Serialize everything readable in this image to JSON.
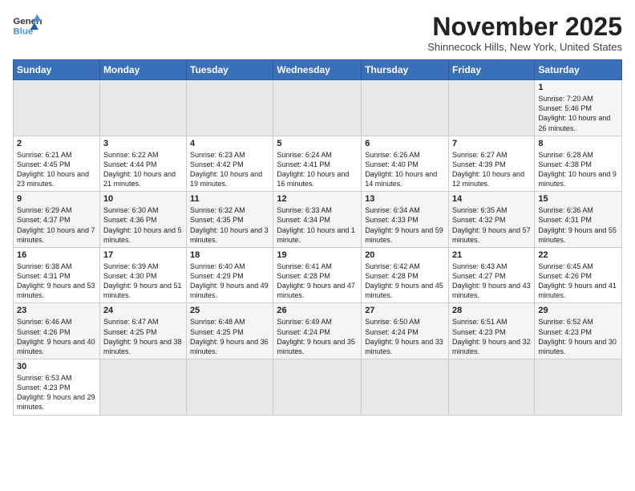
{
  "header": {
    "logo_general": "General",
    "logo_blue": "Blue",
    "month": "November 2025",
    "location": "Shinnecock Hills, New York, United States"
  },
  "weekdays": [
    "Sunday",
    "Monday",
    "Tuesday",
    "Wednesday",
    "Thursday",
    "Friday",
    "Saturday"
  ],
  "weeks": [
    [
      {
        "day": "",
        "info": ""
      },
      {
        "day": "",
        "info": ""
      },
      {
        "day": "",
        "info": ""
      },
      {
        "day": "",
        "info": ""
      },
      {
        "day": "",
        "info": ""
      },
      {
        "day": "",
        "info": ""
      },
      {
        "day": "1",
        "info": "Sunrise: 7:20 AM\nSunset: 5:46 PM\nDaylight: 10 hours and 26 minutes."
      }
    ],
    [
      {
        "day": "2",
        "info": "Sunrise: 6:21 AM\nSunset: 4:45 PM\nDaylight: 10 hours and 23 minutes."
      },
      {
        "day": "3",
        "info": "Sunrise: 6:22 AM\nSunset: 4:44 PM\nDaylight: 10 hours and 21 minutes."
      },
      {
        "day": "4",
        "info": "Sunrise: 6:23 AM\nSunset: 4:42 PM\nDaylight: 10 hours and 19 minutes."
      },
      {
        "day": "5",
        "info": "Sunrise: 6:24 AM\nSunset: 4:41 PM\nDaylight: 10 hours and 16 minutes."
      },
      {
        "day": "6",
        "info": "Sunrise: 6:26 AM\nSunset: 4:40 PM\nDaylight: 10 hours and 14 minutes."
      },
      {
        "day": "7",
        "info": "Sunrise: 6:27 AM\nSunset: 4:39 PM\nDaylight: 10 hours and 12 minutes."
      },
      {
        "day": "8",
        "info": "Sunrise: 6:28 AM\nSunset: 4:38 PM\nDaylight: 10 hours and 9 minutes."
      }
    ],
    [
      {
        "day": "9",
        "info": "Sunrise: 6:29 AM\nSunset: 4:37 PM\nDaylight: 10 hours and 7 minutes."
      },
      {
        "day": "10",
        "info": "Sunrise: 6:30 AM\nSunset: 4:36 PM\nDaylight: 10 hours and 5 minutes."
      },
      {
        "day": "11",
        "info": "Sunrise: 6:32 AM\nSunset: 4:35 PM\nDaylight: 10 hours and 3 minutes."
      },
      {
        "day": "12",
        "info": "Sunrise: 6:33 AM\nSunset: 4:34 PM\nDaylight: 10 hours and 1 minute."
      },
      {
        "day": "13",
        "info": "Sunrise: 6:34 AM\nSunset: 4:33 PM\nDaylight: 9 hours and 59 minutes."
      },
      {
        "day": "14",
        "info": "Sunrise: 6:35 AM\nSunset: 4:32 PM\nDaylight: 9 hours and 57 minutes."
      },
      {
        "day": "15",
        "info": "Sunrise: 6:36 AM\nSunset: 4:31 PM\nDaylight: 9 hours and 55 minutes."
      }
    ],
    [
      {
        "day": "16",
        "info": "Sunrise: 6:38 AM\nSunset: 4:31 PM\nDaylight: 9 hours and 53 minutes."
      },
      {
        "day": "17",
        "info": "Sunrise: 6:39 AM\nSunset: 4:30 PM\nDaylight: 9 hours and 51 minutes."
      },
      {
        "day": "18",
        "info": "Sunrise: 6:40 AM\nSunset: 4:29 PM\nDaylight: 9 hours and 49 minutes."
      },
      {
        "day": "19",
        "info": "Sunrise: 6:41 AM\nSunset: 4:28 PM\nDaylight: 9 hours and 47 minutes."
      },
      {
        "day": "20",
        "info": "Sunrise: 6:42 AM\nSunset: 4:28 PM\nDaylight: 9 hours and 45 minutes."
      },
      {
        "day": "21",
        "info": "Sunrise: 6:43 AM\nSunset: 4:27 PM\nDaylight: 9 hours and 43 minutes."
      },
      {
        "day": "22",
        "info": "Sunrise: 6:45 AM\nSunset: 4:26 PM\nDaylight: 9 hours and 41 minutes."
      }
    ],
    [
      {
        "day": "23",
        "info": "Sunrise: 6:46 AM\nSunset: 4:26 PM\nDaylight: 9 hours and 40 minutes."
      },
      {
        "day": "24",
        "info": "Sunrise: 6:47 AM\nSunset: 4:25 PM\nDaylight: 9 hours and 38 minutes."
      },
      {
        "day": "25",
        "info": "Sunrise: 6:48 AM\nSunset: 4:25 PM\nDaylight: 9 hours and 36 minutes."
      },
      {
        "day": "26",
        "info": "Sunrise: 6:49 AM\nSunset: 4:24 PM\nDaylight: 9 hours and 35 minutes."
      },
      {
        "day": "27",
        "info": "Sunrise: 6:50 AM\nSunset: 4:24 PM\nDaylight: 9 hours and 33 minutes."
      },
      {
        "day": "28",
        "info": "Sunrise: 6:51 AM\nSunset: 4:23 PM\nDaylight: 9 hours and 32 minutes."
      },
      {
        "day": "29",
        "info": "Sunrise: 6:52 AM\nSunset: 4:23 PM\nDaylight: 9 hours and 30 minutes."
      }
    ],
    [
      {
        "day": "30",
        "info": "Sunrise: 6:53 AM\nSunset: 4:23 PM\nDaylight: 9 hours and 29 minutes."
      },
      {
        "day": "",
        "info": ""
      },
      {
        "day": "",
        "info": ""
      },
      {
        "day": "",
        "info": ""
      },
      {
        "day": "",
        "info": ""
      },
      {
        "day": "",
        "info": ""
      },
      {
        "day": "",
        "info": ""
      }
    ]
  ]
}
